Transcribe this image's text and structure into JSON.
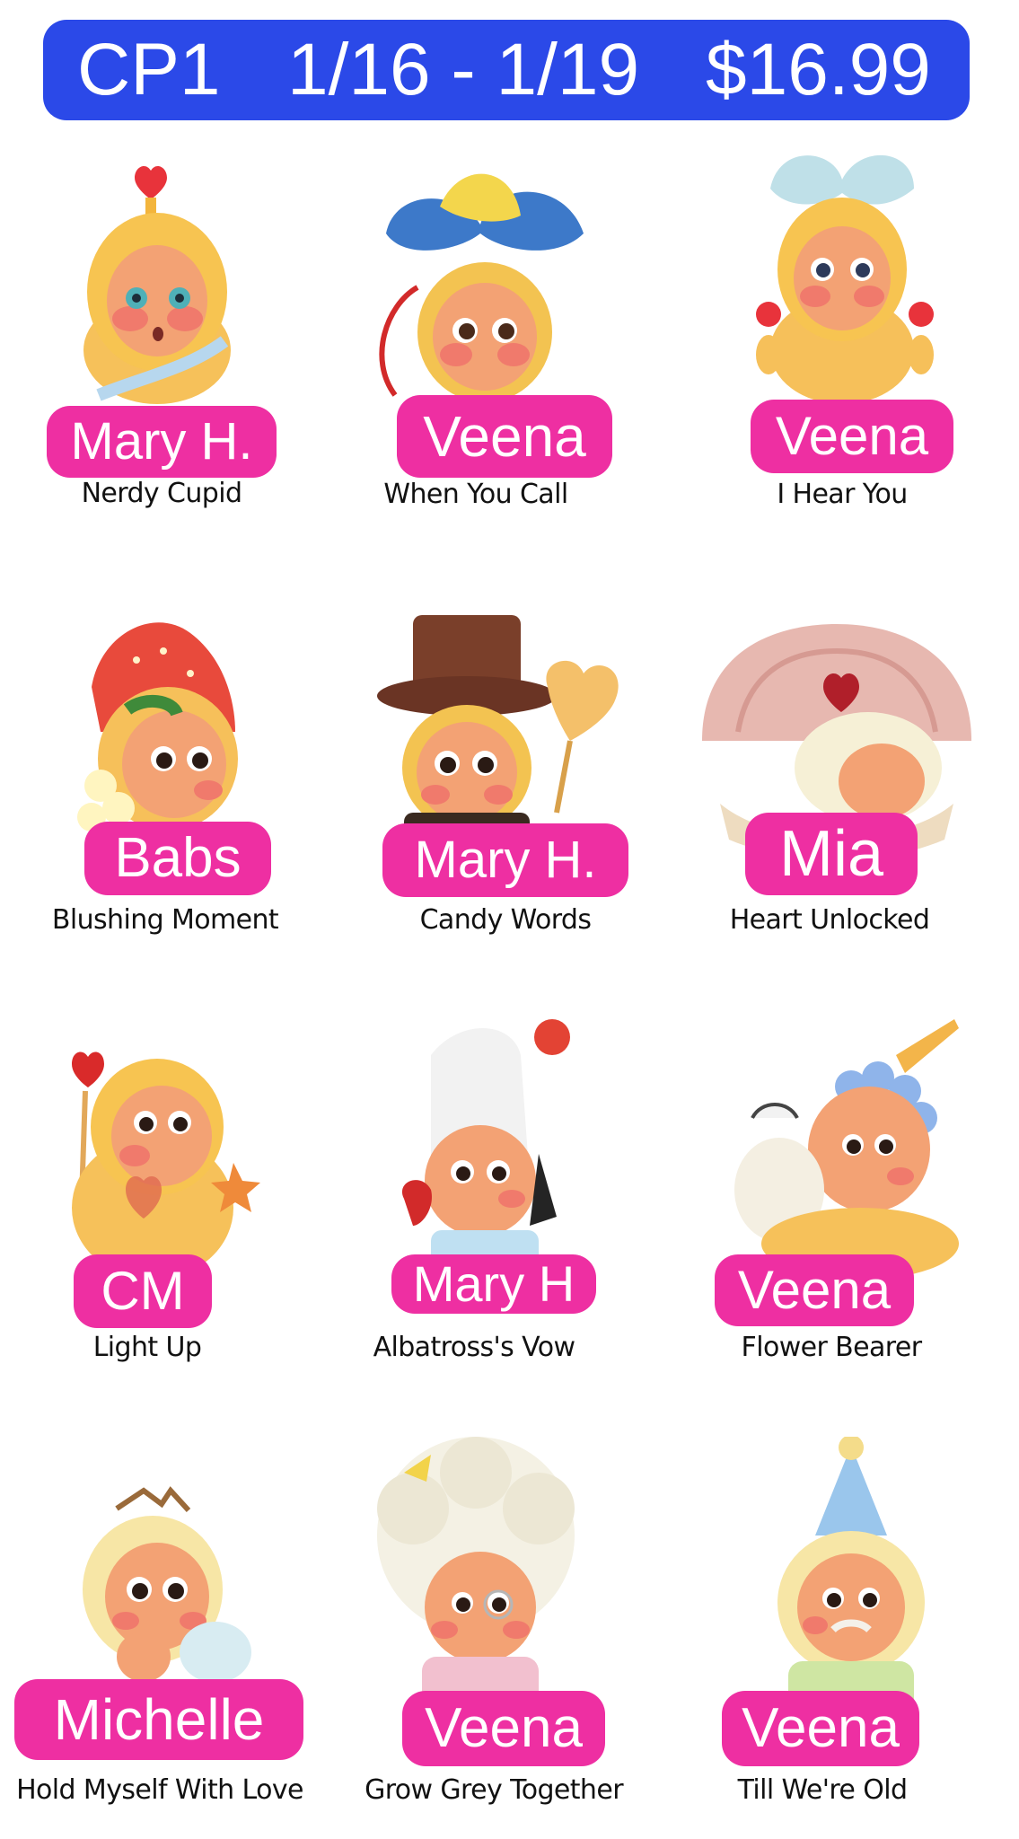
{
  "banner": {
    "code": "CP1",
    "dates": "1/16 - 1/19",
    "price": "$16.99",
    "color": "#2b49e8"
  },
  "accent_color": "#ee2fa2",
  "figures": [
    {
      "name": "Mary H.",
      "title": "Nerdy Cupid"
    },
    {
      "name": "Veena",
      "title": "When You Call"
    },
    {
      "name": "Veena",
      "title": "I Hear You"
    },
    {
      "name": "Babs",
      "title": "Blushing Moment"
    },
    {
      "name": "Mary H.",
      "title": "Candy Words"
    },
    {
      "name": "Mia",
      "title": "Heart Unlocked"
    },
    {
      "name": "CM",
      "title": "Light Up"
    },
    {
      "name": "Mary H",
      "title": "Albatross's Vow"
    },
    {
      "name": "Veena",
      "title": "Flower Bearer"
    },
    {
      "name": "Michelle",
      "title": "Hold Myself With Love"
    },
    {
      "name": "Veena",
      "title": "Grow Grey Together"
    },
    {
      "name": "Veena",
      "title": "Till We're Old"
    }
  ]
}
